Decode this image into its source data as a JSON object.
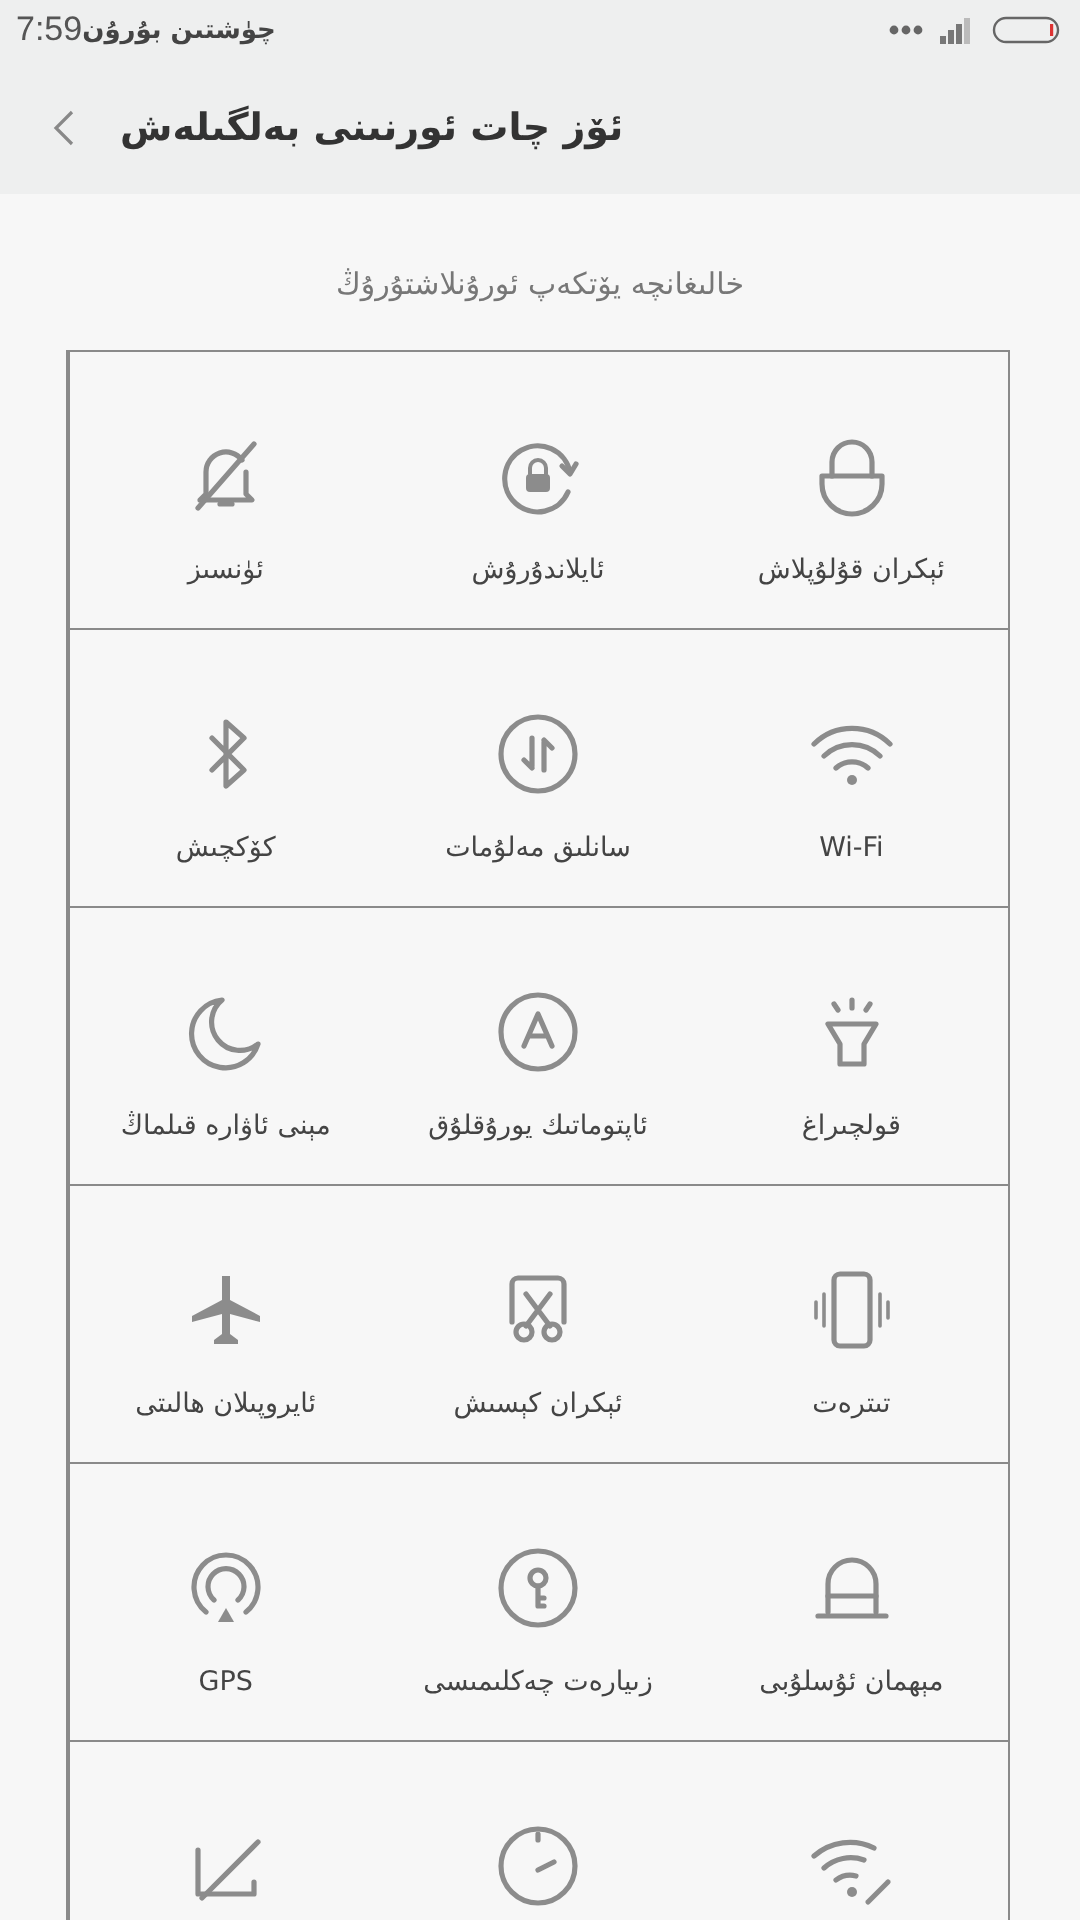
{
  "status_bar": {
    "time": "7:59",
    "period": "چۈشتىن بۇرۇن"
  },
  "header": {
    "title": "ئۆز چات ئورنىنى بەلگىلەش"
  },
  "hint": "خالىغانچە يۆتكەپ ئورۇنلاشتۇرۇڭ",
  "tiles": [
    {
      "kind": "screen-lock",
      "label": "ئېكران قۇلۇپلاش"
    },
    {
      "kind": "rotation-lock",
      "label": "ئايلاندۇرۇش"
    },
    {
      "kind": "mute",
      "label": "ئۈنسىز"
    },
    {
      "kind": "wifi",
      "label": "Wi-Fi"
    },
    {
      "kind": "data",
      "label": "سانلىق مەلۇمات"
    },
    {
      "kind": "bluetooth",
      "label": "كۆكچىش"
    },
    {
      "kind": "flashlight",
      "label": "قولچىراغ"
    },
    {
      "kind": "auto-brightness",
      "label": "ئاپتوماتىك يورۇقلۇق"
    },
    {
      "kind": "do-not-disturb",
      "label": "مېنى ئاۋارە قىلماڭ"
    },
    {
      "kind": "vibrate",
      "label": "تىترەت"
    },
    {
      "kind": "screenshot",
      "label": "ئېكران كېسىش"
    },
    {
      "kind": "airplane",
      "label": "ئايروپىلان ھالىتى"
    },
    {
      "kind": "guest",
      "label": "مېھمان ئۇسلۇبى"
    },
    {
      "kind": "access-limit",
      "label": "زىيارەت چەكلىمىسى"
    },
    {
      "kind": "gps",
      "label": "GPS"
    },
    {
      "kind": "wifi-link"
    },
    {
      "kind": "speed"
    },
    {
      "kind": "cast-off"
    }
  ]
}
